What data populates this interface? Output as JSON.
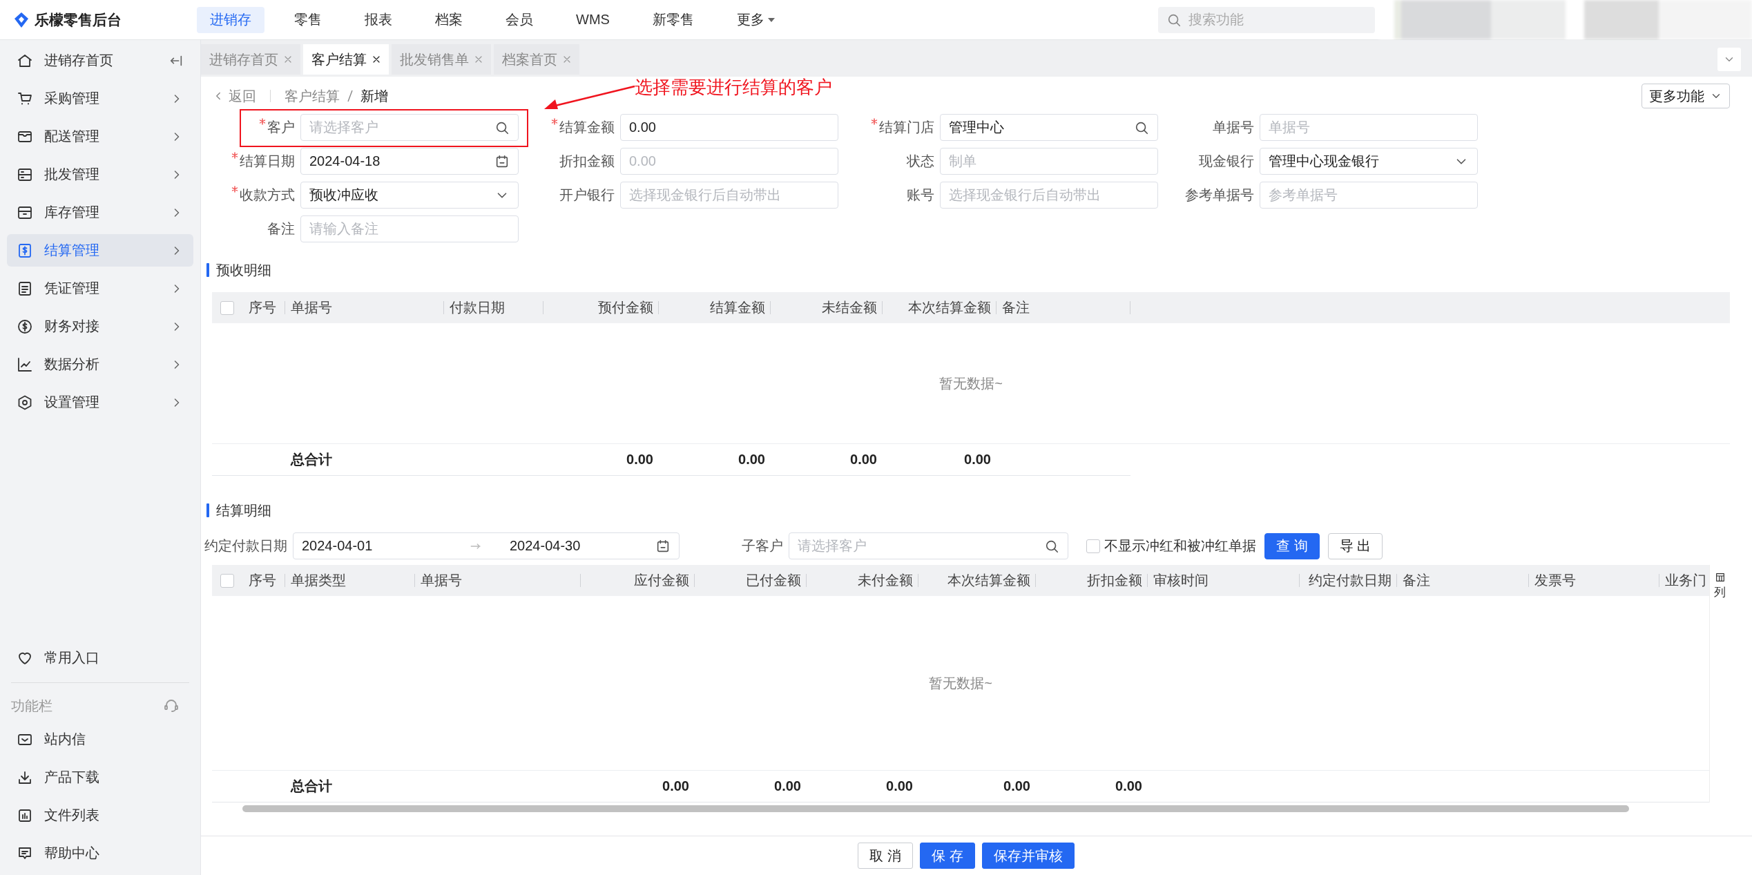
{
  "app": {
    "name": "乐檬零售后台"
  },
  "top_nav": [
    {
      "label": "进销存",
      "selected": true
    },
    {
      "label": "零售",
      "selected": false
    },
    {
      "label": "报表",
      "selected": false
    },
    {
      "label": "档案",
      "selected": false
    },
    {
      "label": "会员",
      "selected": false
    },
    {
      "label": "WMS",
      "selected": false
    },
    {
      "label": "新零售",
      "selected": false
    },
    {
      "label": "更多",
      "selected": false,
      "has_menu": true
    }
  ],
  "search": {
    "placeholder": "搜索功能"
  },
  "sidebar": {
    "items": [
      {
        "label": "进销存首页",
        "kind": "page",
        "selected": false
      },
      {
        "label": "采购管理",
        "kind": "group",
        "selected": false
      },
      {
        "label": "配送管理",
        "kind": "group",
        "selected": false
      },
      {
        "label": "批发管理",
        "kind": "group",
        "selected": false
      },
      {
        "label": "库存管理",
        "kind": "group",
        "selected": false
      },
      {
        "label": "结算管理",
        "kind": "group",
        "selected": true
      },
      {
        "label": "凭证管理",
        "kind": "group",
        "selected": false
      },
      {
        "label": "财务对接",
        "kind": "group",
        "selected": false
      },
      {
        "label": "数据分析",
        "kind": "group",
        "selected": false
      },
      {
        "label": "设置管理",
        "kind": "group",
        "selected": false
      }
    ],
    "favorites": "常用入口",
    "function_bar_label": "功能栏",
    "bottom_items": [
      {
        "label": "站内信"
      },
      {
        "label": "产品下载"
      },
      {
        "label": "文件列表"
      },
      {
        "label": "帮助中心"
      }
    ]
  },
  "tabs": [
    {
      "label": "进销存首页",
      "selected": false
    },
    {
      "label": "客户结算",
      "selected": true
    },
    {
      "label": "批发销售单",
      "selected": false
    },
    {
      "label": "档案首页",
      "selected": false
    }
  ],
  "breadcrumb": {
    "back": "返回",
    "path": "客户结算",
    "current": "新增"
  },
  "more_button": "更多功能",
  "annotation": {
    "text": "选择需要进行结算的客户"
  },
  "form": {
    "fields": [
      {
        "label": "客户",
        "required": true,
        "kind": "search",
        "placeholder": "请选择客户"
      },
      {
        "label": "结算金额",
        "required": true,
        "kind": "text",
        "value": "0.00"
      },
      {
        "label": "结算门店",
        "required": true,
        "kind": "search",
        "value": "管理中心"
      },
      {
        "label": "单据号",
        "required": false,
        "kind": "text",
        "placeholder": "单据号"
      },
      {
        "label": "结算日期",
        "required": true,
        "kind": "date",
        "value": "2024-04-18"
      },
      {
        "label": "折扣金额",
        "required": false,
        "kind": "text",
        "placeholder": "0.00"
      },
      {
        "label": "状态",
        "required": false,
        "kind": "text",
        "placeholder": "制单"
      },
      {
        "label": "现金银行",
        "required": false,
        "kind": "select",
        "value": "管理中心现金银行"
      },
      {
        "label": "收款方式",
        "required": true,
        "kind": "select",
        "value": "预收冲应收"
      },
      {
        "label": "开户银行",
        "required": false,
        "kind": "text",
        "placeholder": "选择现金银行后自动带出"
      },
      {
        "label": "账号",
        "required": false,
        "kind": "text",
        "placeholder": "选择现金银行后自动带出"
      },
      {
        "label": "参考单据号",
        "required": false,
        "kind": "text",
        "placeholder": "参考单据号"
      },
      {
        "label": "备注",
        "required": false,
        "kind": "text",
        "placeholder": "请输入备注"
      }
    ]
  },
  "prepay_section": {
    "title": "预收明细",
    "table": {
      "header_checked": false,
      "empty_text": "暂无数据~",
      "columns": [
        {
          "label": "序号",
          "kind": "text"
        },
        {
          "label": "单据号",
          "kind": "text",
          "total": "总合计"
        },
        {
          "label": "付款日期",
          "kind": "text"
        },
        {
          "label": "预付金额",
          "kind": "amount",
          "total": "0.00"
        },
        {
          "label": "结算金额",
          "kind": "amount",
          "total": "0.00"
        },
        {
          "label": "未结金额",
          "kind": "amount",
          "total": "0.00"
        },
        {
          "label": "本次结算金额",
          "kind": "amount",
          "total": "0.00"
        },
        {
          "label": "备注",
          "kind": "text"
        }
      ]
    }
  },
  "settlement_section": {
    "title": "结算明细",
    "filters": {
      "date_label": "约定付款日期",
      "date_from": "2024-04-01",
      "date_to": "2024-04-30",
      "sub_customer_label": "子客户",
      "sub_customer_placeholder": "请选择客户",
      "hide_red": {
        "label": "不显示冲红和被冲红单据",
        "checked": false
      },
      "query_button": "查 询",
      "export_button": "导 出"
    },
    "table": {
      "header_checked": false,
      "empty_text": "暂无数据~",
      "column_settings_label": "列",
      "columns": [
        {
          "label": "序号",
          "kind": "text"
        },
        {
          "label": "单据类型",
          "kind": "text",
          "total": "总合计"
        },
        {
          "label": "单据号",
          "kind": "text"
        },
        {
          "label": "应付金额",
          "kind": "amount",
          "total": "0.00"
        },
        {
          "label": "已付金额",
          "kind": "amount",
          "total": "0.00"
        },
        {
          "label": "未付金额",
          "kind": "amount",
          "total": "0.00"
        },
        {
          "label": "本次结算金额",
          "kind": "amount",
          "total": "0.00"
        },
        {
          "label": "折扣金额",
          "kind": "amount",
          "total": "0.00"
        },
        {
          "label": "审核时间",
          "kind": "text"
        },
        {
          "label": "约定付款日期",
          "kind": "due_date"
        },
        {
          "label": "备注",
          "kind": "text"
        },
        {
          "label": "发票号",
          "kind": "text"
        },
        {
          "label": "业务门",
          "kind": "text"
        }
      ]
    }
  },
  "footer_buttons": [
    {
      "label": "取 消",
      "kind": "default"
    },
    {
      "label": "保 存",
      "kind": "primary"
    },
    {
      "label": "保存并审核",
      "kind": "primary"
    }
  ]
}
